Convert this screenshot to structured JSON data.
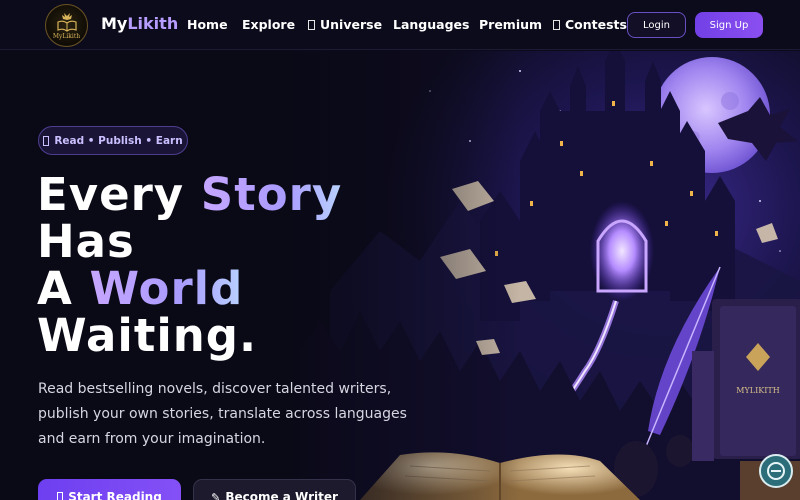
{
  "brand": {
    "name_prefix": "My",
    "name_accent": "Likith",
    "logo_text": "MyLikith",
    "logo_icon": "book-crown-logo-icon"
  },
  "nav": {
    "items": [
      {
        "label": "Home"
      },
      {
        "label": "Explore"
      },
      {
        "label": "Universe",
        "icon": "universe-icon"
      },
      {
        "label": "Languages"
      },
      {
        "label": "Premium"
      },
      {
        "label": "Contests",
        "icon": "trophy-icon"
      }
    ],
    "login_label": "Login",
    "signup_label": "Sign Up"
  },
  "hero": {
    "tagline": "Read • Publish • Earn",
    "tagline_icon": "sparkle-icon",
    "headline": {
      "line1_a": "Every ",
      "line1_b": "Story",
      "line2": "Has",
      "line3_a": "A ",
      "line3_b": "World",
      "line4": "Waiting."
    },
    "subtext": "Read bestselling novels, discover talented writers, publish your own stories, translate across languages and earn from your imagination.",
    "primary_cta": "Start Reading",
    "primary_cta_icon": "book-icon",
    "secondary_cta": "Become a Writer",
    "secondary_cta_icon": "pen-icon",
    "book_spine_text": "MYLIKITH"
  },
  "colors": {
    "background": "#0b0a1a",
    "accent": "#7a47ee",
    "accent_light": "#b79dff",
    "nav_bg": "#0c0b1c"
  }
}
